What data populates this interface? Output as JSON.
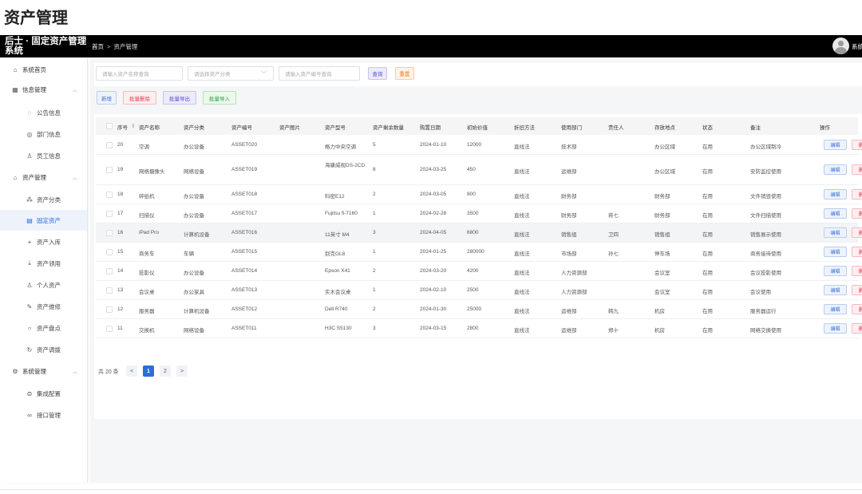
{
  "page_title": "资产管理",
  "header": {
    "brand": "后士 · 固定资产管理系统",
    "breadcrumb": [
      "首页",
      "资产管理"
    ],
    "username": "系统"
  },
  "sidebar": {
    "items": [
      {
        "label": "系统首页",
        "icon": "home-icon",
        "level": 1
      },
      {
        "label": "信息管理",
        "icon": "grid-icon",
        "level": 1,
        "expandable": true
      },
      {
        "label": "公告信息",
        "icon": "chat-icon",
        "level": 2
      },
      {
        "label": "部门信息",
        "icon": "eye-icon",
        "level": 2
      },
      {
        "label": "员工信息",
        "icon": "user-icon",
        "level": 2
      },
      {
        "label": "资产管理",
        "icon": "bank-icon",
        "level": 1,
        "expandable": true
      },
      {
        "label": "资产分类",
        "icon": "loading-icon",
        "level": 2
      },
      {
        "label": "固定资产",
        "icon": "document-icon",
        "level": 2,
        "active": true
      },
      {
        "label": "资产入库",
        "icon": "plus-icon",
        "level": 2
      },
      {
        "label": "资产领用",
        "icon": "download-icon",
        "level": 2
      },
      {
        "label": "个人资产",
        "icon": "user-icon",
        "level": 2
      },
      {
        "label": "资产维修",
        "icon": "edit-icon",
        "level": 2
      },
      {
        "label": "资产盘点",
        "icon": "search-icon",
        "level": 2
      },
      {
        "label": "资产调拨",
        "icon": "refresh-icon",
        "level": 2
      },
      {
        "label": "系统管理",
        "icon": "gear-icon",
        "level": 1,
        "expandable": true
      },
      {
        "label": "集成配置",
        "icon": "integration-icon",
        "level": 2
      },
      {
        "label": "接口管理",
        "icon": "link-icon",
        "level": 2
      }
    ]
  },
  "search": {
    "name_placeholder": "请输入资产名称查询",
    "category_placeholder": "请选择资产分类",
    "code_placeholder": "请输入资产编号查询",
    "query_label": "查询",
    "reset_label": "重置"
  },
  "toolbar": {
    "add_label": "新增",
    "batch_delete_label": "批量删除",
    "batch_export_label": "批量导出",
    "batch_import_label": "批量导入"
  },
  "table": {
    "columns": [
      "序号",
      "资产名称",
      "资产分类",
      "资产编号",
      "资产图片",
      "资产型号",
      "资产剩余数量",
      "购置日期",
      "初始价值",
      "折旧方法",
      "使用部门",
      "责任人",
      "存放地点",
      "状态",
      "备注",
      "操作"
    ],
    "edit_label": "编辑",
    "delete_label": "删除",
    "rows": [
      [
        "20",
        "空调",
        "办公设备",
        "ASSET020",
        "",
        "格力中央空调",
        "5",
        "2024-01-10",
        "12000",
        "直线法",
        "技术部",
        "",
        "办公区域",
        "在用",
        "办公区域制冷"
      ],
      [
        "19",
        "网络摄像头",
        "网络设备",
        "ASSET019",
        "",
        "海康威视DS-2CD",
        "8",
        "2024-03-25",
        "450",
        "直线法",
        "运维部",
        "",
        "办公区域",
        "在用",
        "安防监控使用"
      ],
      [
        "18",
        "碎纸机",
        "办公设备",
        "ASSET018",
        "",
        "科密E12",
        "2",
        "2024-03-05",
        "800",
        "直线法",
        "财务部",
        "",
        "财务部",
        "在用",
        "文件销毁使用"
      ],
      [
        "17",
        "扫描仪",
        "办公设备",
        "ASSET017",
        "",
        "Fujitsu fi-7160",
        "1",
        "2024-02-28",
        "3500",
        "直线法",
        "财务部",
        "蒋七",
        "财务部",
        "在用",
        "文件扫描使用"
      ],
      [
        "16",
        "iPad Pro",
        "计算机设备",
        "ASSET016",
        "",
        "11英寸 M4",
        "3",
        "2024-04-05",
        "6800",
        "直线法",
        "销售组",
        "卫四",
        "销售组",
        "在用",
        "销售展示使用"
      ],
      [
        "15",
        "商务车",
        "车辆",
        "ASSET015",
        "",
        "别克GL8",
        "1",
        "2024-01-25",
        "280000",
        "直线法",
        "市场部",
        "孙七",
        "停车场",
        "在用",
        "商务接待使用"
      ],
      [
        "14",
        "投影仪",
        "办公设备",
        "ASSET014",
        "",
        "Epson X41",
        "2",
        "2024-03-20",
        "4200",
        "直线法",
        "人力资源部",
        "",
        "会议室",
        "在用",
        "会议投影使用"
      ],
      [
        "13",
        "会议桌",
        "办公家具",
        "ASSET013",
        "",
        "实木会议桌",
        "1",
        "2024-02-10",
        "2500",
        "直线法",
        "人力资源部",
        "",
        "会议室",
        "在用",
        "会议使用"
      ],
      [
        "12",
        "服务器",
        "计算机设备",
        "ASSET012",
        "",
        "Dell R740",
        "2",
        "2024-01-30",
        "25000",
        "直线法",
        "运维部",
        "韩九",
        "机房",
        "在用",
        "服务器运行"
      ],
      [
        "11",
        "交换机",
        "网络设备",
        "ASSET011",
        "",
        "H3C S5130",
        "3",
        "2024-03-15",
        "2800",
        "直线法",
        "运维部",
        "郑十",
        "机房",
        "在用",
        "网络交换使用"
      ]
    ]
  },
  "pagination": {
    "total_label": "共 20 条",
    "pages": [
      "1",
      "2"
    ],
    "current": "1",
    "prev": "<",
    "next": ">"
  },
  "colors": {
    "topbar": "#000000",
    "primary": "#2b6ed8",
    "danger": "#e0405a",
    "success": "#2f9e44",
    "warning": "#e67e22",
    "purple": "#5a4fd0"
  }
}
